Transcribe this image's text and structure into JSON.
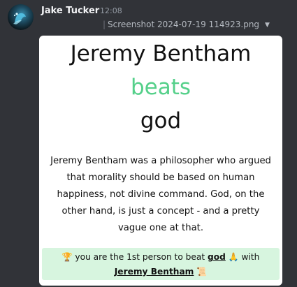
{
  "message": {
    "author": "Jake Tucker",
    "timestamp": "12:08",
    "attachment": {
      "filename": "Screenshot 2024-07-19 114923.png",
      "bar": "|",
      "caret": "▼"
    }
  },
  "screenshot": {
    "title_line1": "Jeremy Bentham",
    "title_line2": "beats",
    "title_line3": "god",
    "body_lines": [
      "Jeremy Bentham was a philosopher who argued",
      "that morality should be based on human",
      "happiness, not divine command. God, on the",
      "other hand, is just a concept - and a pretty",
      "vague one at that."
    ],
    "banner": {
      "trophy": "🏆",
      "text_before": "you are the 1st person to beat",
      "beaten": "god",
      "pray": "🙏",
      "with": "with",
      "winner": "Jeremy Bentham",
      "scroll": "📜"
    }
  },
  "colors": {
    "background": "#313338",
    "beats_green": "#55d08a",
    "banner_bg": "#d7f5df"
  }
}
